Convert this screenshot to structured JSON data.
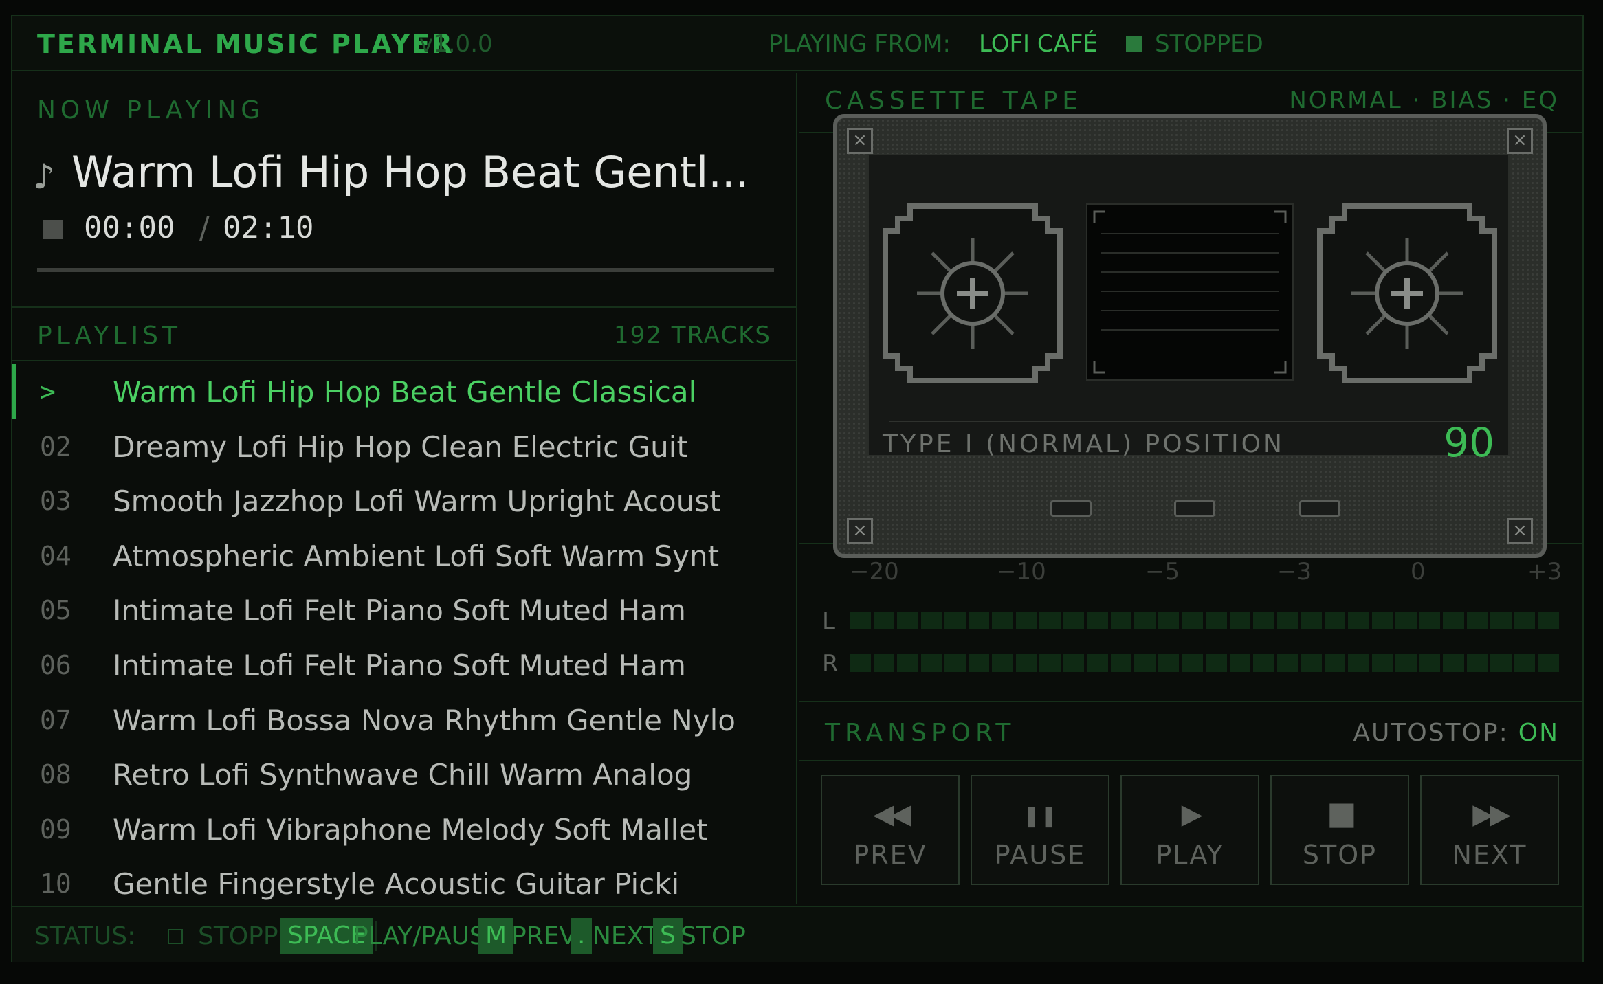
{
  "header": {
    "app_title": "TERMINAL MUSIC PLAYER",
    "version": "v1.0.0",
    "source_label": "PLAYING FROM:",
    "source": "LOFI CAFÉ",
    "state": "STOPPED"
  },
  "now_playing": {
    "section_title": "NOW PLAYING",
    "track": "Warm Lofi Hip Hop Beat Gentl...",
    "time_current": "00:00",
    "time_sep": "/",
    "time_total": "02:10",
    "progress": 0
  },
  "playlist": {
    "section_title": "PLAYLIST",
    "count": "192 TRACKS",
    "items": [
      {
        "num": ">",
        "name": "Warm Lofi Hip Hop Beat Gentle Classical",
        "active": true
      },
      {
        "num": "02",
        "name": "Dreamy Lofi Hip Hop Clean Electric Guit"
      },
      {
        "num": "03",
        "name": "Smooth Jazzhop Lofi Warm Upright Acoust"
      },
      {
        "num": "04",
        "name": "Atmospheric Ambient Lofi Soft Warm Synt"
      },
      {
        "num": "05",
        "name": "Intimate Lofi Felt Piano Soft Muted Ham"
      },
      {
        "num": "06",
        "name": "Intimate Lofi Felt Piano Soft Muted Ham"
      },
      {
        "num": "07",
        "name": "Warm Lofi Bossa Nova Rhythm Gentle Nylo"
      },
      {
        "num": "08",
        "name": "Retro Lofi Synthwave Chill Warm Analog"
      },
      {
        "num": "09",
        "name": "Warm Lofi Vibraphone Melody Soft Mallet"
      },
      {
        "num": "10",
        "name": "Gentle Fingerstyle Acoustic Guitar Picki"
      }
    ]
  },
  "cassette": {
    "section_title": "CASSETTE TAPE",
    "modes": "NORMAL · BIAS · EQ",
    "tape_type": "TYPE I (NORMAL) POSITION",
    "position": "90"
  },
  "vu": {
    "scale": [
      "−20",
      "−10",
      "−5",
      "−3",
      "0",
      "+3"
    ],
    "left_label": "L",
    "right_label": "R",
    "left_level": 0,
    "right_level": 0
  },
  "transport": {
    "section_title": "TRANSPORT",
    "autostop_label": "AUTOSTOP:",
    "autostop_value": "ON",
    "buttons": [
      {
        "icon": "prev-icon",
        "glyph": "◀◀",
        "label": "PREV"
      },
      {
        "icon": "pause-icon",
        "glyph": "❚❚",
        "label": "PAUSE"
      },
      {
        "icon": "play-icon",
        "glyph": "▶",
        "label": "PLAY"
      },
      {
        "icon": "stop-icon",
        "glyph": "■",
        "label": "STOP"
      },
      {
        "icon": "next-icon",
        "glyph": "▶▶",
        "label": "NEXT"
      }
    ]
  },
  "footer": {
    "status_label": "STATUS:",
    "status": "STOPPED",
    "shortcuts": [
      {
        "key": "SPACE",
        "desc": "PLAY/PAUSE"
      },
      {
        "key": "M",
        "desc": "PREV"
      },
      {
        "key": ".",
        "desc": "NEXT"
      },
      {
        "key": "S",
        "desc": "STOP"
      }
    ]
  },
  "colors": {
    "accent": "#3dbb55",
    "accent_dim": "#1f6a30",
    "background": "#0a0d0a",
    "border": "#16301a"
  }
}
